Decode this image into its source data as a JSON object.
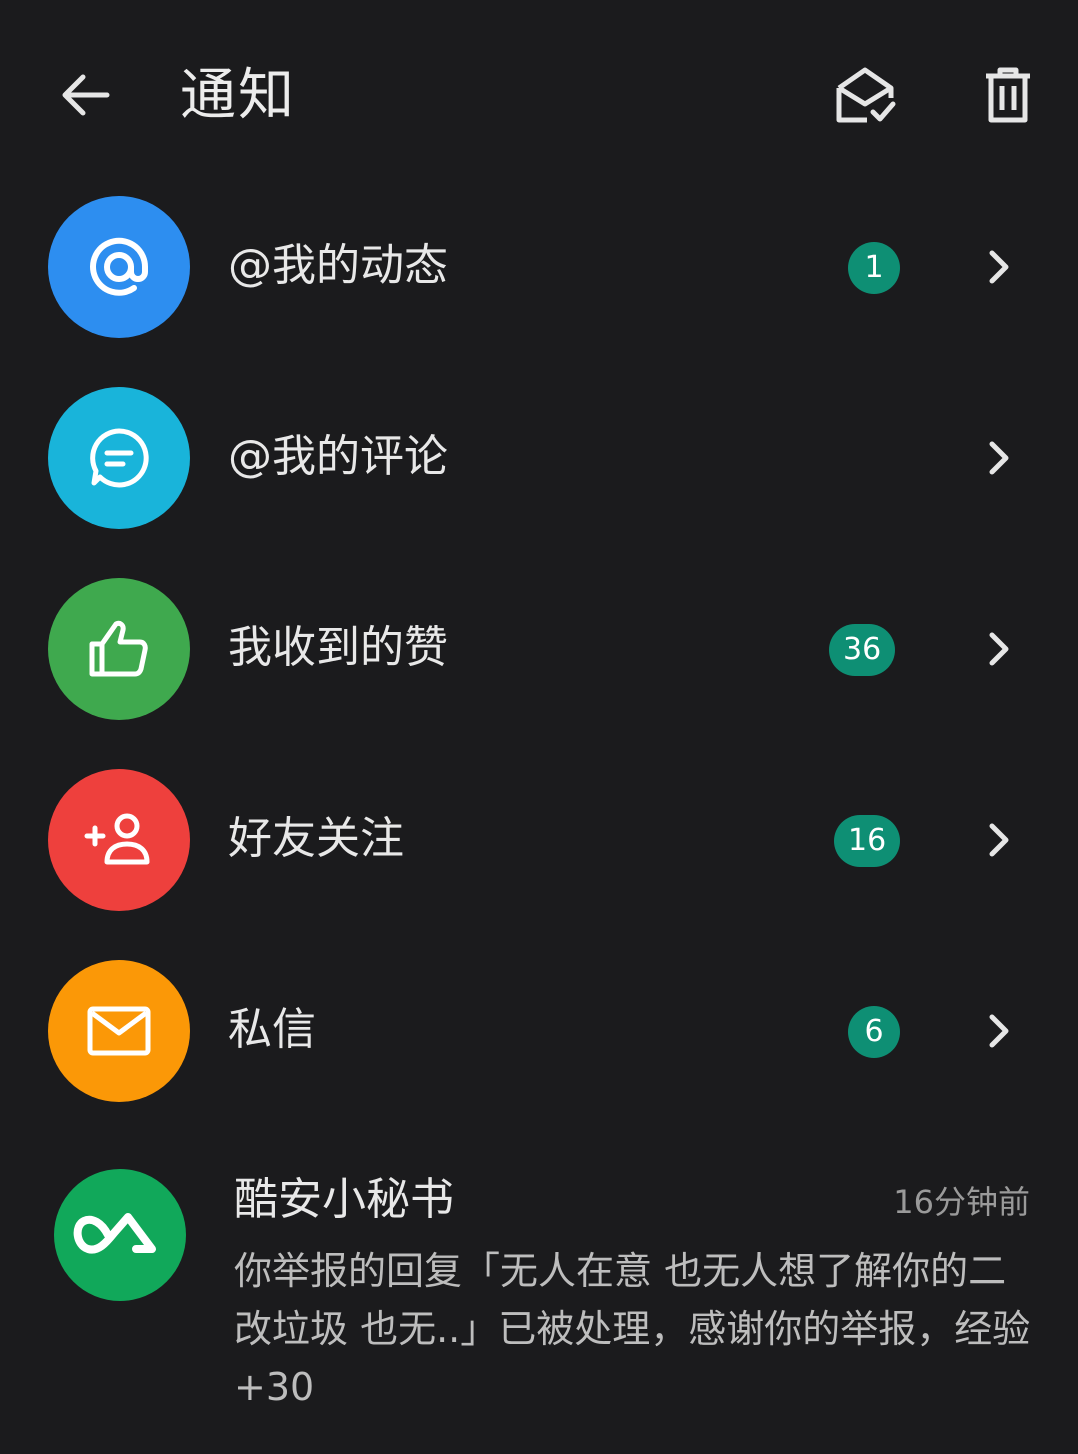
{
  "header": {
    "title": "通知",
    "icons": {
      "back": "arrow-left-icon",
      "mark_read": "envelope-open-check-icon",
      "delete": "trash-icon"
    }
  },
  "items": [
    {
      "label": "@我的动态",
      "badge": "1",
      "icon": "at-icon",
      "color": "#2d8ef0"
    },
    {
      "label": "@我的评论",
      "badge": "",
      "icon": "comment-icon",
      "color": "#19b4da"
    },
    {
      "label": "我收到的赞",
      "badge": "36",
      "icon": "thumbs-up-icon",
      "color": "#3fa94e"
    },
    {
      "label": "好友关注",
      "badge": "16",
      "icon": "add-user-icon",
      "color": "#ee403d"
    },
    {
      "label": "私信",
      "badge": "6",
      "icon": "mail-icon",
      "color": "#fb9807"
    }
  ],
  "system_message": {
    "name": "酷安小秘书",
    "time": "16分钟前",
    "text": "你举报的回复「无人在意 也无人想了解你的二改垃圾 也无..」已被处理，感谢你的举报，经验+30",
    "icon": "coolapk-logo-icon",
    "color": "#11a85a"
  },
  "colors": {
    "background": "#1b1b1d",
    "badge": "#0e8f74"
  }
}
